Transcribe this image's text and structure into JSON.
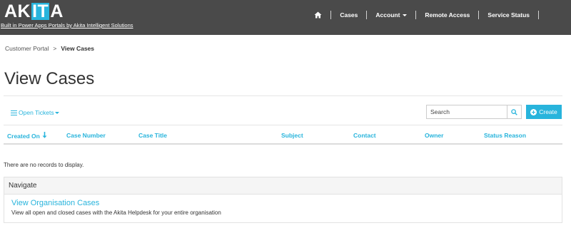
{
  "brand": {
    "logo_parts": [
      "AK",
      "IT",
      "A"
    ],
    "tagline": "Built in Power Apps Portals by Akita Intelligent Solutions",
    "accent_color": "#28b4dc",
    "navbar_color": "#4a4a4a"
  },
  "nav": {
    "home_icon": "home-icon",
    "items": [
      "Cases",
      "Account",
      "Remote Access",
      "Service Status"
    ]
  },
  "breadcrumb": {
    "parent": "Customer Portal",
    "separator": ">",
    "current": "View Cases"
  },
  "page": {
    "title": "View Cases"
  },
  "toolbar": {
    "view_label": "Open Tickets",
    "search_placeholder": "Search",
    "create_label": "Create"
  },
  "table": {
    "columns": [
      "Created On",
      "Case Number",
      "Case Title",
      "Subject",
      "Contact",
      "Owner",
      "Status Reason"
    ],
    "sorted_column": "Created On",
    "sort_direction": "descending",
    "empty_message": "There are no records to display."
  },
  "navigate": {
    "heading": "Navigate",
    "link_label": "View Organisation Cases",
    "link_description": "View all open and closed cases with the Akita Helpdesk for your entire organisation"
  }
}
